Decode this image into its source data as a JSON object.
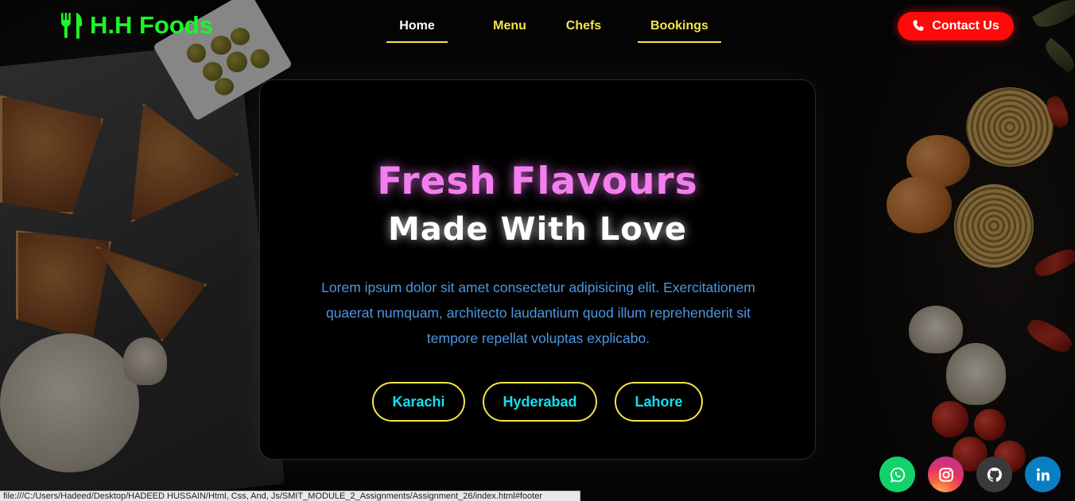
{
  "brand": {
    "name": "H.H Foods",
    "icon": "utensils-icon",
    "color": "#1cf52a"
  },
  "nav": {
    "items": [
      {
        "label": "Home",
        "state": "active"
      },
      {
        "label": "Menu",
        "state": "normal"
      },
      {
        "label": "Chefs",
        "state": "normal"
      },
      {
        "label": "Bookings",
        "state": "hover"
      }
    ],
    "accent": "#f5e44a"
  },
  "contact": {
    "label": "Contact Us",
    "icon": "phone-icon",
    "color": "#ff0a0a"
  },
  "hero": {
    "title": "Fresh Flavours",
    "subtitle": "Made With Love",
    "text": "Lorem ipsum dolor sit amet consectetur adipisicing elit. Exercitationem quaerat numquam, architecto laudantium quod illum reprehenderit sit tempore repellat voluptas explicabo.",
    "title_color": "#f47ef0",
    "text_color": "#4d97e2",
    "cities": [
      "Karachi",
      "Hyderabad",
      "Lahore"
    ]
  },
  "social": [
    {
      "name": "whatsapp",
      "icon": "whatsapp-icon",
      "color": "#12d36b"
    },
    {
      "name": "instagram",
      "icon": "instagram-icon",
      "color": "#e1306c"
    },
    {
      "name": "github",
      "icon": "github-icon",
      "color": "#3a3a3a"
    },
    {
      "name": "linkedin",
      "icon": "linkedin-icon",
      "color": "#0a7ec2"
    }
  ],
  "status_url": "file:///C:/Users/Hadeed/Desktop/HADEED HUSSAIN/Html, Css, And, Js/SMIT_MODULE_2_Assignments/Assignment_26/index.html#footer"
}
